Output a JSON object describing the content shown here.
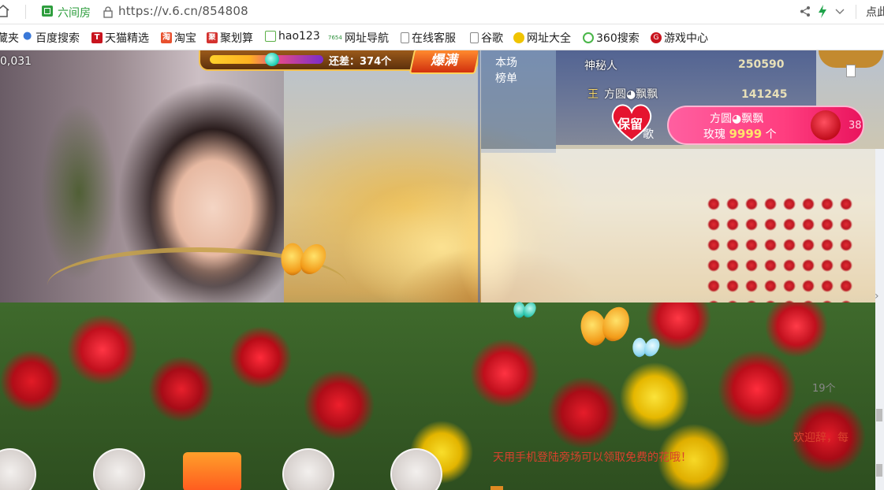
{
  "browser": {
    "site_name": "六间房",
    "url": "https://v.6.cn/854808",
    "right_label": "点此"
  },
  "bookmarks": [
    {
      "label": "藏夹",
      "icon": "folder-icon"
    },
    {
      "label": "百度搜索",
      "icon": "baidu-paw-icon"
    },
    {
      "label": "天猫精选",
      "icon": "tmall-icon",
      "glyph": "T"
    },
    {
      "label": "淘宝",
      "icon": "taobao-icon",
      "glyph": "淘"
    },
    {
      "label": "聚划算",
      "icon": "juhuasuan-icon",
      "glyph": "聚"
    },
    {
      "label": "hao123",
      "icon": "hao123-icon"
    },
    {
      "label": "网址导航",
      "icon": "7654-icon",
      "glyph": "7654"
    },
    {
      "label": "在线客服",
      "icon": "document-icon"
    },
    {
      "label": "谷歌",
      "icon": "document-icon"
    },
    {
      "label": "网址大全",
      "icon": "smiley-icon"
    },
    {
      "label": "360搜索",
      "icon": "360-icon"
    },
    {
      "label": "游戏中心",
      "icon": "game-icon",
      "glyph": "G"
    }
  ],
  "stage": {
    "viewer_count": "0,031",
    "progress_label": "还差：374个",
    "progress_fraction": 0.55,
    "burst_label": "爆满"
  },
  "ranking": {
    "tab_label": "本场榜单",
    "entries": [
      {
        "name": "神秘人",
        "score": "250590"
      },
      {
        "name": "方圆◕飘飘",
        "score": "141245"
      }
    ],
    "crown_prefix": "王"
  },
  "gift_banner": {
    "user": "方圆◕飘飘",
    "gift": "玫瑰",
    "amount": "9999",
    "unit": "个",
    "side_count": "38"
  },
  "keep": {
    "label": "保留",
    "song_fragment": "歌"
  },
  "chat": {
    "line1": "欢迎辞，每",
    "line2": "天用手机登陆旁场可以领取免费的花哦！",
    "stat_fragment": "19个"
  },
  "colors": {
    "accent_green": "#2e9e3e",
    "chat_red": "#d9412d",
    "banner_pink": "#ff3d7f"
  }
}
